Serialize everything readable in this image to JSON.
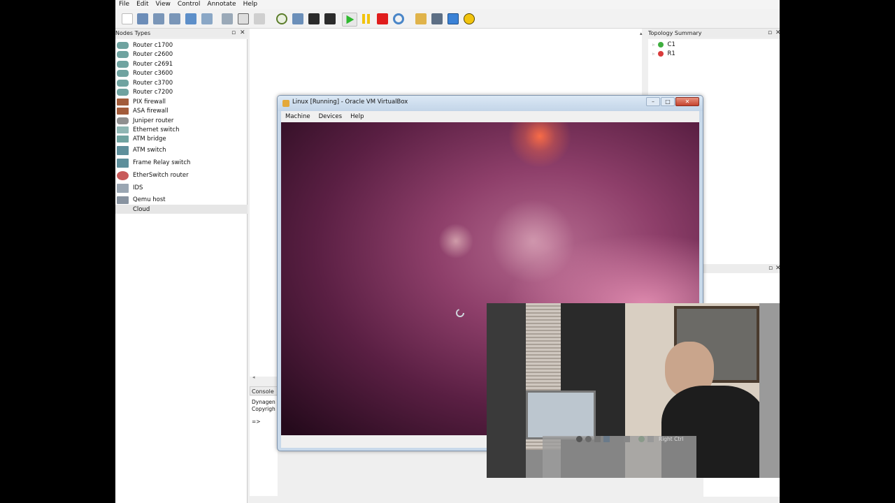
{
  "menubar": {
    "items": [
      "File",
      "Edit",
      "View",
      "Control",
      "Annotate",
      "Help"
    ]
  },
  "toolbar": {
    "icons": [
      "new-icon",
      "open-icon",
      "save-icon",
      "save-as-icon",
      "import-icon",
      "export-icon",
      "hostname-icon",
      "interface-icon",
      "capture-icon",
      "compiler-icon",
      "terminal-icon",
      "console-icon",
      "start-icon",
      "pause-icon",
      "stop-icon",
      "reload-icon",
      "note-icon",
      "screenshot-icon",
      "rectangle-icon",
      "ellipse-icon"
    ]
  },
  "nodes_panel": {
    "title": "Nodes Types",
    "items": [
      {
        "label": "Router c1700",
        "icon": "router-icon"
      },
      {
        "label": "Router c2600",
        "icon": "router-icon"
      },
      {
        "label": "Router c2691",
        "icon": "router-icon"
      },
      {
        "label": "Router c3600",
        "icon": "router-icon"
      },
      {
        "label": "Router c3700",
        "icon": "router-icon"
      },
      {
        "label": "Router c7200",
        "icon": "router-icon"
      },
      {
        "label": "PIX firewall",
        "icon": "firewall-icon"
      },
      {
        "label": "ASA firewall",
        "icon": "firewall-icon"
      },
      {
        "label": "Juniper router",
        "icon": "router-icon"
      },
      {
        "label": "Ethernet switch",
        "icon": "switch-icon"
      },
      {
        "label": "ATM bridge",
        "icon": "bridge-icon"
      },
      {
        "label": "ATM switch",
        "icon": "atm-switch-icon"
      },
      {
        "label": "Frame Relay switch",
        "icon": "frame-relay-icon"
      },
      {
        "label": "EtherSwitch router",
        "icon": "etherswitch-icon"
      },
      {
        "label": "IDS",
        "icon": "ids-icon"
      },
      {
        "label": "Qemu host",
        "icon": "host-icon"
      },
      {
        "label": "Cloud",
        "icon": "cloud-icon"
      }
    ]
  },
  "topology_summary": {
    "title": "Topology Summary",
    "items": [
      {
        "label": "C1",
        "status_color": "#3fae3f"
      },
      {
        "label": "R1",
        "status_color": "#d93b3b"
      }
    ]
  },
  "console": {
    "title": "Console",
    "lines": [
      "Dynagen",
      "Copyrigh",
      "=>"
    ]
  },
  "vbox": {
    "title": "Linux [Running] - Oracle VM VirtualBox",
    "menu": [
      "Machine",
      "Devices",
      "Help"
    ],
    "host_key": "Right Ctrl"
  },
  "colors": {
    "accent_green": "#2db82d",
    "pause_yellow": "#f2c40e",
    "stop_red": "#e01d1d",
    "rect_blue": "#3b82d6",
    "ellipse_yellow": "#f2c40e"
  }
}
